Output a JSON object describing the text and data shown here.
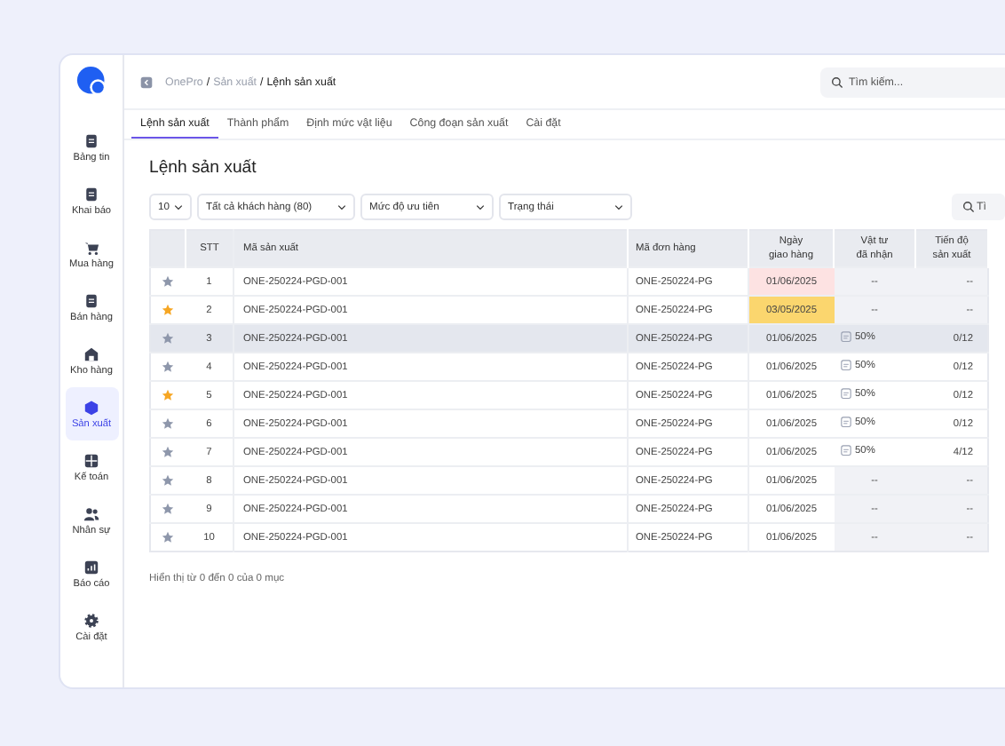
{
  "breadcrumb": [
    {
      "kind": "link",
      "text": "OnePro"
    },
    {
      "kind": "sep",
      "text": "/"
    },
    {
      "kind": "link",
      "text": "Sản xuất"
    },
    {
      "kind": "sep",
      "text": "/"
    },
    {
      "kind": "current",
      "text": "Lệnh sản xuất"
    }
  ],
  "top_search": {
    "placeholder": "Tìm kiếm..."
  },
  "sidebar": {
    "items": [
      {
        "label": "Bảng tin",
        "selected": false
      },
      {
        "label": "Khai báo",
        "selected": false
      },
      {
        "label": "Mua hàng",
        "selected": false
      },
      {
        "label": "Bán hàng",
        "selected": false
      },
      {
        "label": "Kho hàng",
        "selected": false
      },
      {
        "label": "Sản xuất",
        "selected": true
      },
      {
        "label": "Kế toán",
        "selected": false
      },
      {
        "label": "Nhân sự",
        "selected": false
      },
      {
        "label": "Báo cáo",
        "selected": false
      },
      {
        "label": "Cài đặt",
        "selected": false
      }
    ]
  },
  "tabs": [
    {
      "label": "Lệnh sản xuất",
      "selected": true
    },
    {
      "label": "Thành phẩm",
      "selected": false
    },
    {
      "label": "Định mức vật liệu",
      "selected": false
    },
    {
      "label": "Công đoạn sản xuất",
      "selected": false
    },
    {
      "label": "Cài đặt",
      "selected": false
    }
  ],
  "page_title": "Lệnh sản xuất",
  "filters": [
    {
      "value": "10"
    },
    {
      "value": "Tất cả khách hàng (80)"
    },
    {
      "value": "Mức độ ưu tiên"
    },
    {
      "value": "Trạng thái"
    }
  ],
  "table_search": {
    "placeholder": "Tì"
  },
  "table": {
    "columns": [
      "STT",
      "Mã sản xuất",
      "Mã đơn hàng",
      "Ngày\ngiao hàng",
      "Vật tư\nđã nhận",
      "Tiến độ\nsản xuất"
    ],
    "rows": [
      {
        "starred": false,
        "selected": false,
        "stt": "1",
        "code": "ONE-250224-PGD-001",
        "order": "ONE-250224-PG",
        "date": {
          "text": "01/06/2025",
          "color": "#fde2e2"
        },
        "material": {
          "kind": "empty",
          "text": "--"
        },
        "progress": "--"
      },
      {
        "starred": true,
        "selected": false,
        "stt": "2",
        "code": "ONE-250224-PGD-001",
        "order": "ONE-250224-PG",
        "date": {
          "text": "03/05/2025",
          "color": "#fbd66e"
        },
        "material": {
          "kind": "empty",
          "text": "--"
        },
        "progress": "--"
      },
      {
        "starred": false,
        "selected": true,
        "stt": "3",
        "code": "ONE-250224-PGD-001",
        "order": "ONE-250224-PG",
        "date": {
          "text": "01/06/2025"
        },
        "material": {
          "kind": "received",
          "text": "50%"
        },
        "progress": "0/12"
      },
      {
        "starred": false,
        "selected": false,
        "stt": "4",
        "code": "ONE-250224-PGD-001",
        "order": "ONE-250224-PG",
        "date": {
          "text": "01/06/2025"
        },
        "material": {
          "kind": "received",
          "text": "50%"
        },
        "progress": "0/12"
      },
      {
        "starred": true,
        "selected": false,
        "stt": "5",
        "code": "ONE-250224-PGD-001",
        "order": "ONE-250224-PG",
        "date": {
          "text": "01/06/2025"
        },
        "material": {
          "kind": "received",
          "text": "50%"
        },
        "progress": "0/12"
      },
      {
        "starred": false,
        "selected": false,
        "stt": "6",
        "code": "ONE-250224-PGD-001",
        "order": "ONE-250224-PG",
        "date": {
          "text": "01/06/2025"
        },
        "material": {
          "kind": "received",
          "text": "50%"
        },
        "progress": "0/12"
      },
      {
        "starred": false,
        "selected": false,
        "stt": "7",
        "code": "ONE-250224-PGD-001",
        "order": "ONE-250224-PG",
        "date": {
          "text": "01/06/2025"
        },
        "material": {
          "kind": "received",
          "text": "50%"
        },
        "progress": "4/12"
      },
      {
        "starred": false,
        "selected": false,
        "stt": "8",
        "code": "ONE-250224-PGD-001",
        "order": "ONE-250224-PG",
        "date": {
          "text": "01/06/2025"
        },
        "material": {
          "kind": "empty",
          "text": "--"
        },
        "progress": "--"
      },
      {
        "starred": false,
        "selected": false,
        "stt": "9",
        "code": "ONE-250224-PGD-001",
        "order": "ONE-250224-PG",
        "date": {
          "text": "01/06/2025"
        },
        "material": {
          "kind": "empty",
          "text": "--"
        },
        "progress": "--"
      },
      {
        "starred": false,
        "selected": false,
        "stt": "10",
        "code": "ONE-250224-PGD-001",
        "order": "ONE-250224-PG",
        "date": {
          "text": "01/06/2025"
        },
        "material": {
          "kind": "empty",
          "text": "--"
        },
        "progress": "--"
      }
    ]
  },
  "footer": "Hiển thị từ 0 đến 0 của 0 mục"
}
